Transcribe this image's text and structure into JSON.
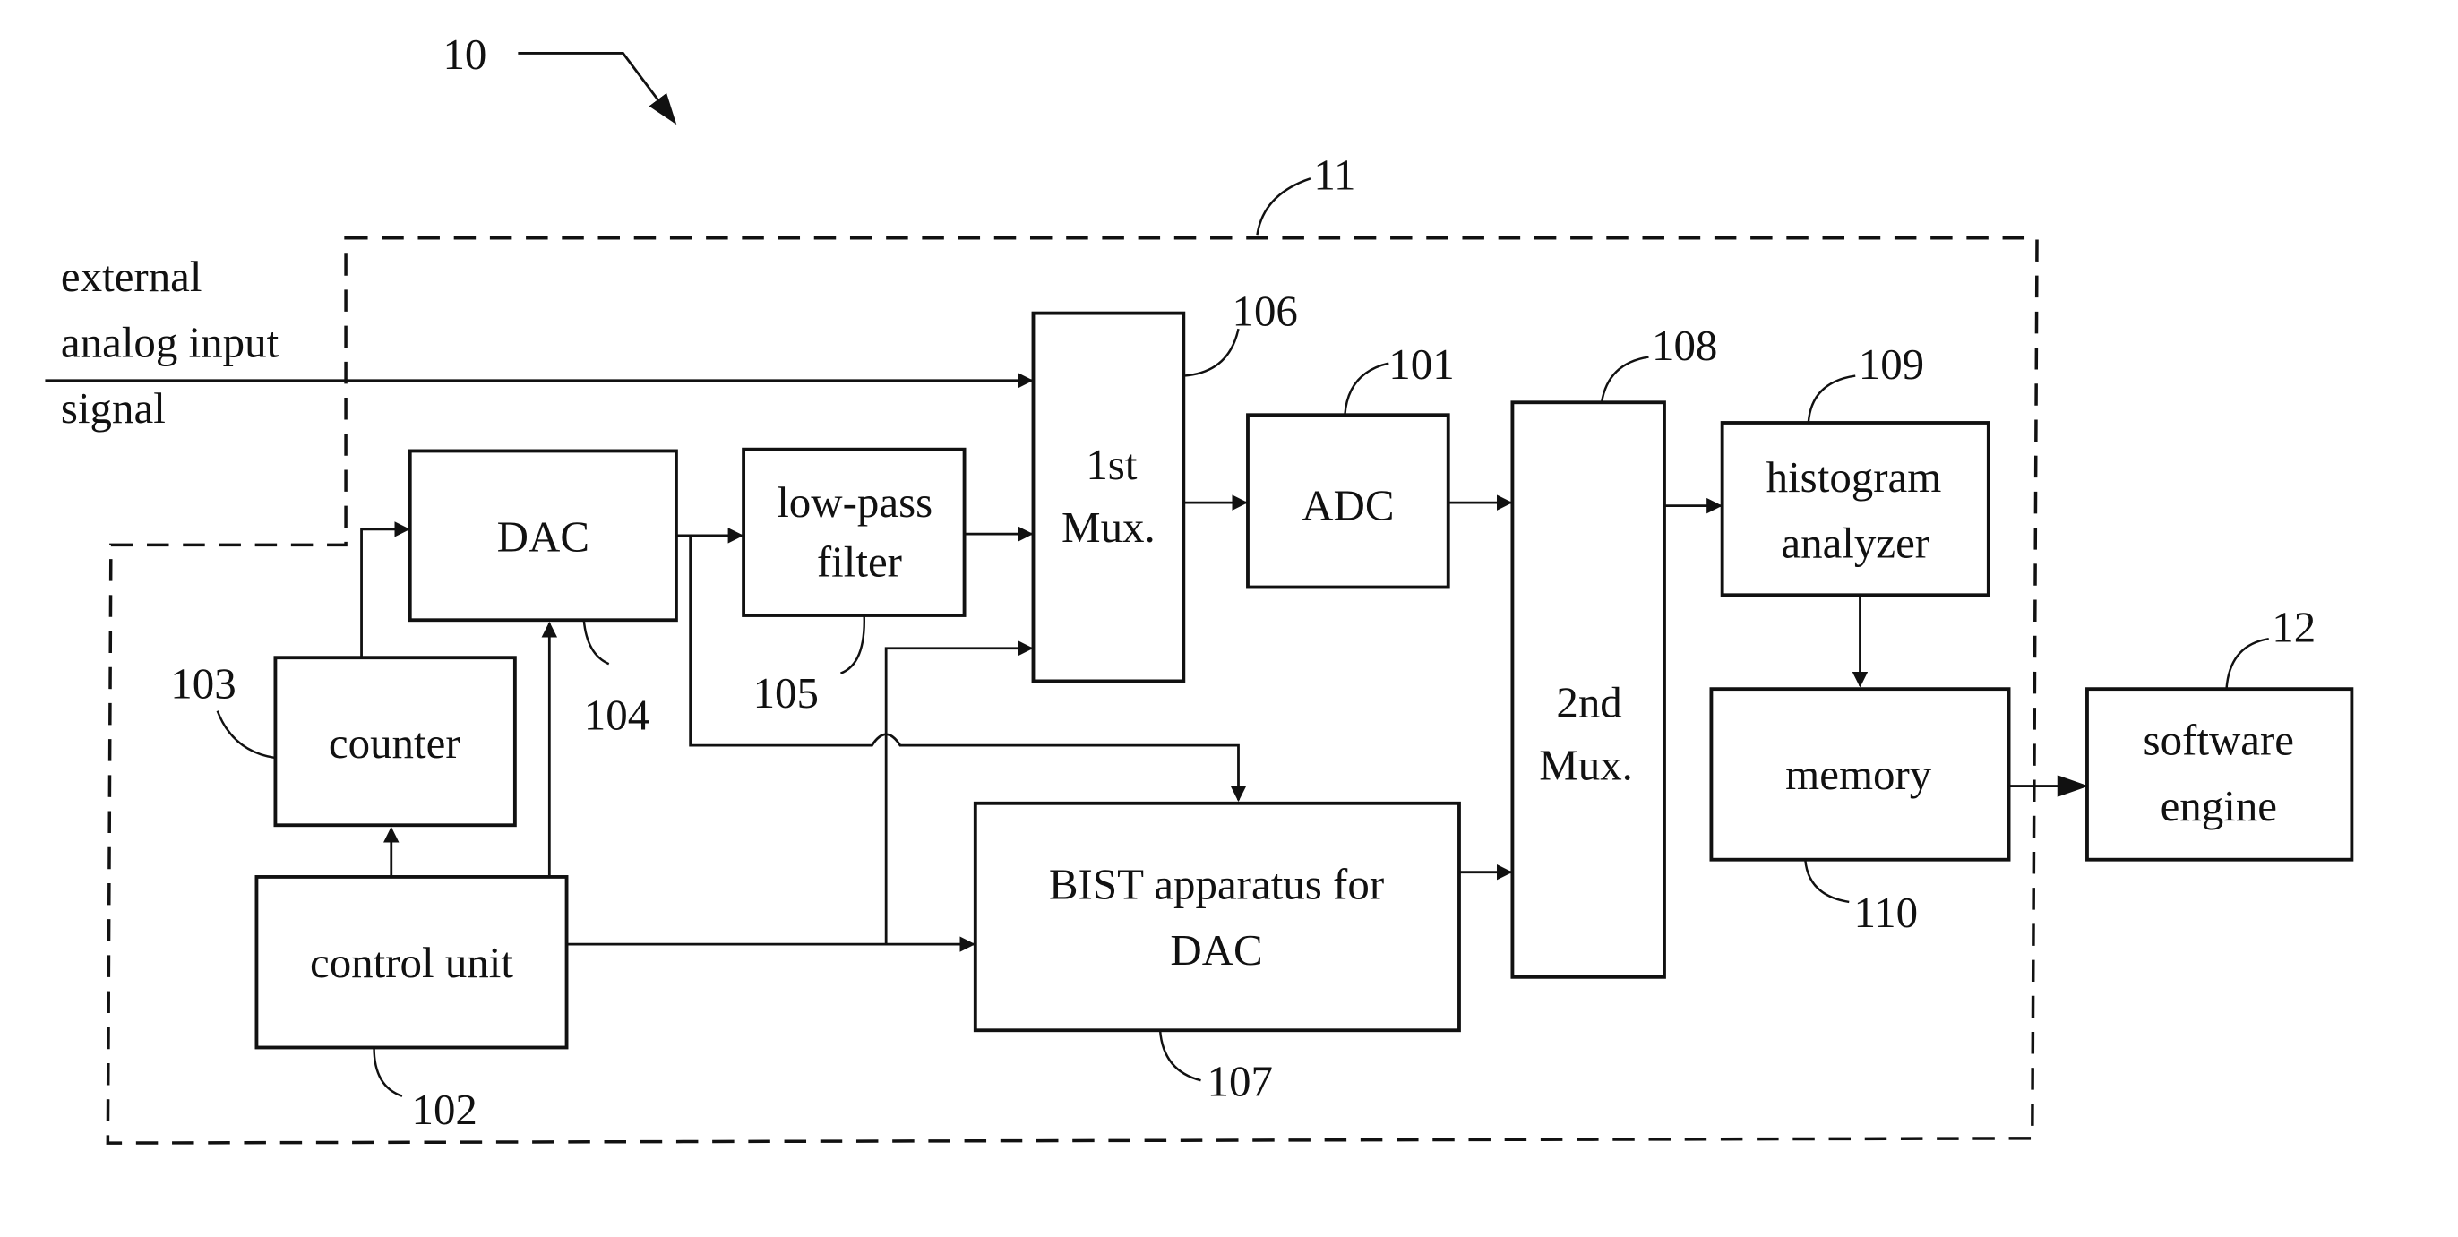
{
  "figure": {
    "ref": "10",
    "chip_ref": "11",
    "external_input_lines": [
      "external",
      "analog input",
      "signal"
    ]
  },
  "blocks": {
    "dac": {
      "label": "DAC",
      "ref": "104"
    },
    "lpf": {
      "lines": [
        "low-pass",
        "filter"
      ],
      "ref": "105"
    },
    "mux1": {
      "lines": [
        "1st",
        "Mux."
      ],
      "ref": "106"
    },
    "adc": {
      "label": "ADC",
      "ref": "101"
    },
    "mux2": {
      "lines": [
        "2nd",
        "Mux."
      ],
      "ref": "108"
    },
    "histogram": {
      "lines": [
        "histogram",
        "analyzer"
      ],
      "ref": "109"
    },
    "memory": {
      "label": "memory",
      "ref": "110"
    },
    "software": {
      "lines": [
        "software",
        "engine"
      ],
      "ref": "12"
    },
    "counter": {
      "label": "counter",
      "ref": "103"
    },
    "control": {
      "label": "control unit",
      "ref": "102"
    },
    "bist": {
      "lines": [
        "BIST apparatus for",
        "DAC"
      ],
      "ref": "107"
    }
  },
  "colors": {
    "ink": "#111111",
    "paper": "#ffffff"
  }
}
